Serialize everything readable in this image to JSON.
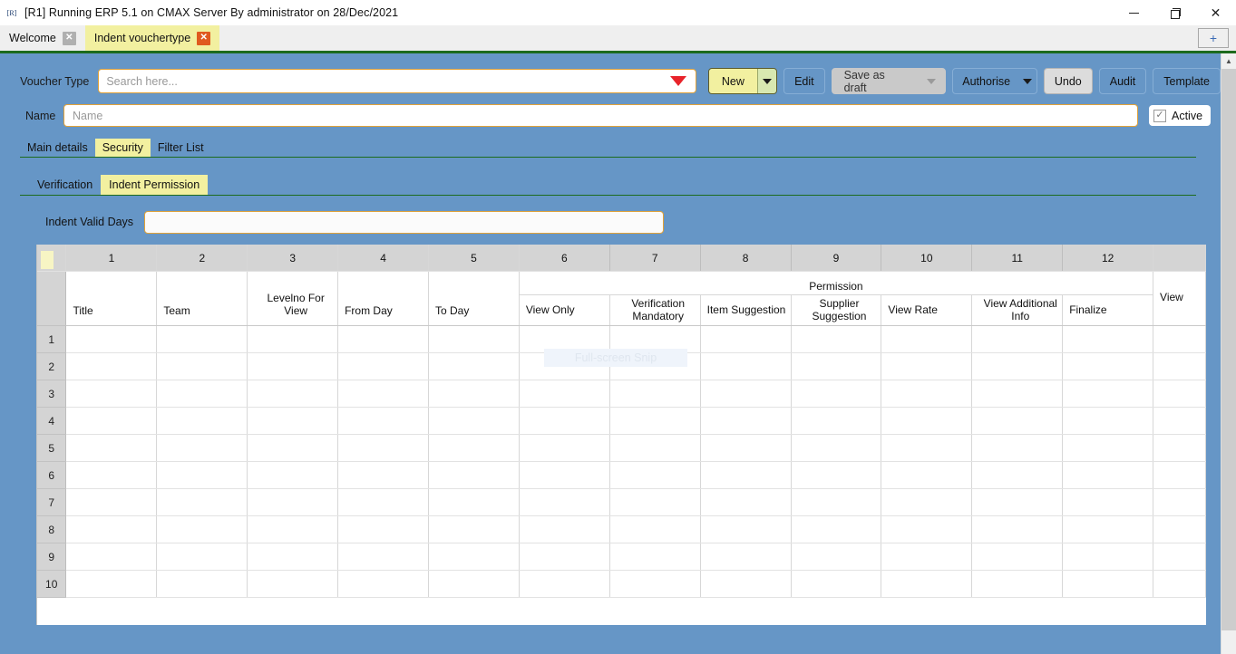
{
  "window": {
    "title": "[R1] Running ERP 5.1 on CMAX Server By administrator on 28/Dec/2021",
    "icon": "app-icon",
    "minimize": "—",
    "maximize": "restore-icon",
    "close": "✕"
  },
  "tabs": {
    "items": [
      {
        "label": "Welcome",
        "close": "✕",
        "active": false
      },
      {
        "label": "Indent vouchertype",
        "close": "✕",
        "active": true
      }
    ],
    "add_label": "+"
  },
  "toolbar": {
    "voucher_type_label": "Voucher Type",
    "search_placeholder": "Search here...",
    "search_value": "",
    "new_label": "New",
    "edit_label": "Edit",
    "save_as_draft_label": "Save as draft",
    "authorise_label": "Authorise",
    "undo_label": "Undo",
    "audit_label": "Audit",
    "template_label": "Template"
  },
  "form": {
    "name_label": "Name",
    "name_placeholder": "Name",
    "name_value": "",
    "active_label": "Active",
    "active_checked": true,
    "check_glyph": "✓"
  },
  "tabs_level1": [
    {
      "label": "Main details",
      "selected": false
    },
    {
      "label": "Security",
      "selected": true
    },
    {
      "label": "Filter List",
      "selected": false
    }
  ],
  "tabs_level2": [
    {
      "label": "Verification",
      "selected": false
    },
    {
      "label": "Indent Permission",
      "selected": true
    }
  ],
  "indent": {
    "valid_days_label": "Indent Valid Days",
    "valid_days_value": ""
  },
  "grid": {
    "column_numbers": [
      "1",
      "2",
      "3",
      "4",
      "5",
      "6",
      "7",
      "8",
      "9",
      "10",
      "11",
      "12",
      ""
    ],
    "plain_headers": [
      "Title",
      "Team",
      "Levelno For View",
      "From Day",
      "To Day"
    ],
    "group_header": "Permission",
    "permission_headers": [
      "View Only",
      "Verification Mandatory",
      "Item Suggestion",
      "Supplier Suggestion",
      "View Rate",
      "View Additional Info",
      "Finalize"
    ],
    "clipped_header": "View",
    "row_numbers": [
      "1",
      "2",
      "3",
      "4",
      "5",
      "6",
      "7",
      "8",
      "9",
      "10"
    ]
  },
  "overlay": {
    "ghost_text": "Full-screen Snip"
  },
  "scrollbar": {
    "up_arrow": "▲"
  },
  "colors": {
    "app_background": "#6696c6",
    "accent_yellow": "#f2f0a0",
    "field_border": "#e0a23a",
    "tab_underline": "#1d6b1d",
    "close_active": "#e05a1e",
    "caret_red": "#e8232a"
  }
}
